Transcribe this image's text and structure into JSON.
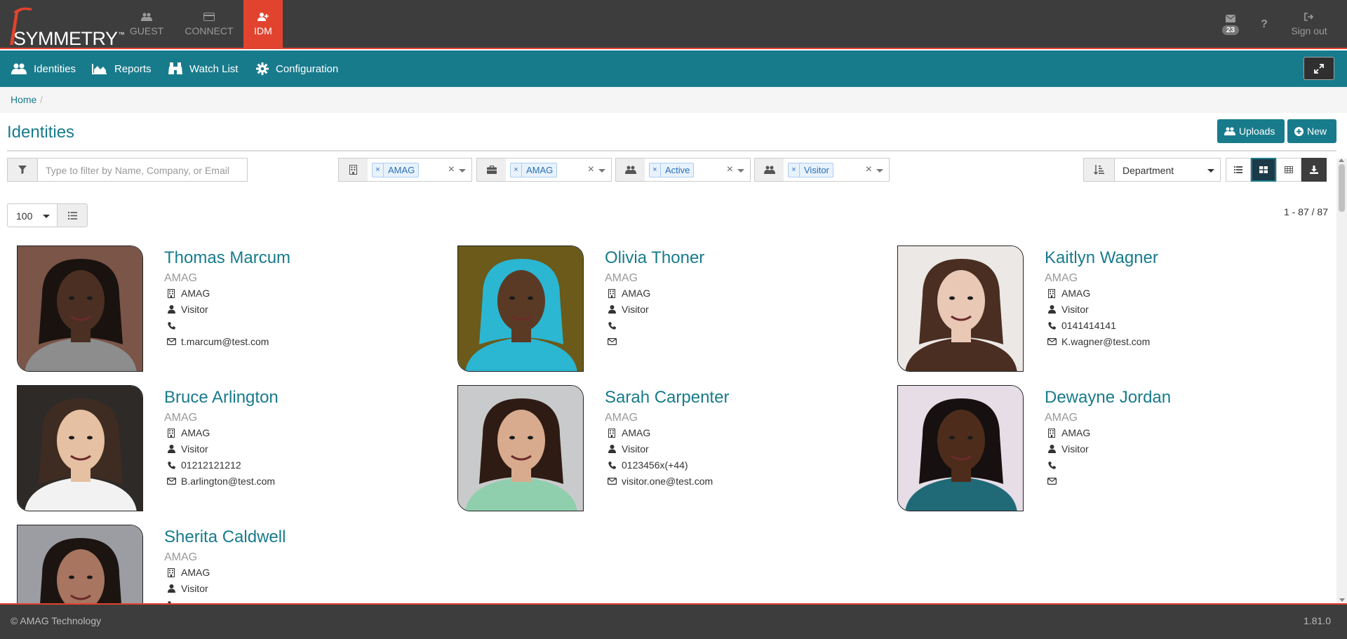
{
  "brand": {
    "logo_text": "SYMMETRY",
    "trademark": "™"
  },
  "app_tabs": [
    {
      "label": "GUEST",
      "icon": "users-icon"
    },
    {
      "label": "CONNECT",
      "icon": "credit-card-icon"
    },
    {
      "label": "IDM",
      "icon": "user-plus-icon",
      "active": true
    }
  ],
  "top_right": {
    "messages_count": "23",
    "help_label": "?",
    "signout_label": "Sign out"
  },
  "nav": [
    {
      "label": "Identities",
      "icon": "users-icon"
    },
    {
      "label": "Reports",
      "icon": "area-chart-icon"
    },
    {
      "label": "Watch List",
      "icon": "binoculars-icon"
    },
    {
      "label": "Configuration",
      "icon": "gear-icon"
    }
  ],
  "breadcrumb": {
    "home": "Home",
    "separator": "/"
  },
  "page_title": "Identities",
  "buttons": {
    "uploads": "Uploads",
    "new": "New"
  },
  "filter": {
    "placeholder": "Type to filter by Name, Company, or Email"
  },
  "select_filters": [
    {
      "icon": "building-icon",
      "tag": "AMAG"
    },
    {
      "icon": "briefcase-icon",
      "tag": "AMAG"
    },
    {
      "icon": "users-icon",
      "tag": "Active"
    },
    {
      "icon": "users-icon",
      "tag": "Visitor"
    }
  ],
  "sort": {
    "selected": "Department"
  },
  "per_page": "100",
  "result_count": "1 - 87 / 87",
  "identities": [
    {
      "name": "Thomas Marcum",
      "company": "AMAG",
      "department": "AMAG",
      "type": "Visitor",
      "phone": "",
      "email": "t.marcum@test.com",
      "skin": "#4a2f22",
      "hair": "#1a120e",
      "bg": "#7a5548",
      "shirt": "#8d8d8d"
    },
    {
      "name": "Olivia Thoner",
      "company": "AMAG",
      "department": "AMAG",
      "type": "Visitor",
      "phone": "",
      "email": "",
      "skin": "#5b3a25",
      "hair": "#2bb6d2",
      "bg": "#6b5a1a",
      "shirt": "#2bb6d2"
    },
    {
      "name": "Kaitlyn Wagner",
      "company": "AMAG",
      "department": "AMAG",
      "type": "Visitor",
      "phone": "0141414141",
      "email": "K.wagner@test.com",
      "skin": "#e9c8b6",
      "hair": "#4a2e22",
      "bg": "#ece8e6",
      "shirt": "#4a2e22"
    },
    {
      "name": "Bruce Arlington",
      "company": "AMAG",
      "department": "AMAG",
      "type": "Visitor",
      "phone": "01212121212",
      "email": "B.arlington@test.com",
      "skin": "#e6c0a2",
      "hair": "#3e2c22",
      "bg": "#2e2a27",
      "shirt": "#f2f2f2"
    },
    {
      "name": "Sarah Carpenter",
      "company": "AMAG",
      "department": "AMAG",
      "type": "Visitor",
      "phone": "0123456x(+44)",
      "email": "visitor.one@test.com",
      "skin": "#d8ab8e",
      "hair": "#2e1c14",
      "bg": "#c9cacb",
      "shirt": "#8fcfae"
    },
    {
      "name": "Dewayne Jordan",
      "company": "AMAG",
      "department": "AMAG",
      "type": "Visitor",
      "phone": "",
      "email": "",
      "skin": "#4e2c1c",
      "hair": "#161010",
      "bg": "#e6dde6",
      "shirt": "#206a78"
    },
    {
      "name": "Sherita Caldwell",
      "company": "AMAG",
      "department": "AMAG",
      "type": "Visitor",
      "phone": "",
      "email": "",
      "skin": "#a77560",
      "hair": "#1c1410",
      "bg": "#9c9ca3",
      "shirt": "#333333"
    }
  ],
  "footer": {
    "copyright": "© AMAG Technology",
    "version": "1.81.0"
  },
  "colors": {
    "teal": "#187b8c",
    "red": "#e2432f",
    "dark": "#3d3d3d"
  }
}
